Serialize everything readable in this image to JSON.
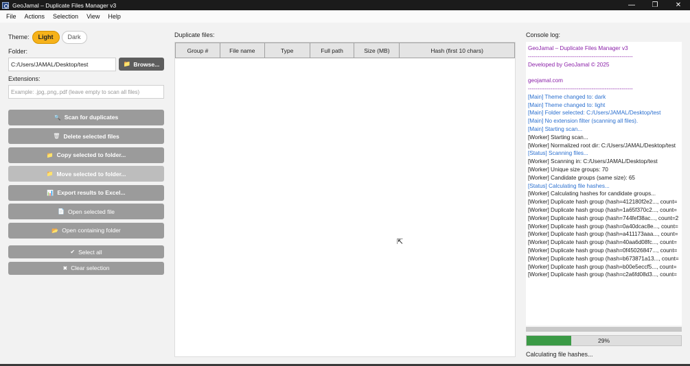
{
  "window": {
    "title": "GeoJamal – Duplicate Files Manager v3",
    "controls": {
      "minimize": "—",
      "restore": "❐",
      "close": "✕"
    }
  },
  "menu": [
    "File",
    "Actions",
    "Selection",
    "View",
    "Help"
  ],
  "left": {
    "theme_label": "Theme:",
    "theme_light": "Light",
    "theme_dark": "Dark",
    "folder_label": "Folder:",
    "folder_value": "C:/Users/JAMAL/Desktop/test",
    "browse_icon": "📁",
    "browse_label": "Browse...",
    "extensions_label": "Extensions:",
    "extensions_placeholder": "Example: .jpg,.png,.pdf (leave empty to scan all files)",
    "buttons": [
      {
        "icon": "🔍",
        "label": "Scan for duplicates"
      },
      {
        "icon": "🗑",
        "label": "Delete selected files"
      },
      {
        "icon": "📁",
        "label": "Copy selected to folder..."
      },
      {
        "icon": "📁",
        "label": "Move selected to folder..."
      },
      {
        "icon": "📊",
        "label": "Export results to Excel..."
      },
      {
        "icon": "📄",
        "label": "Open selected file"
      },
      {
        "icon": "📂",
        "label": "Open containing folder"
      }
    ],
    "select_all": {
      "icon": "✔",
      "label": "Select all"
    },
    "clear_selection": {
      "icon": "✖",
      "label": "Clear selection"
    }
  },
  "main": {
    "label": "Duplicate files:",
    "columns": [
      "Group #",
      "File name",
      "Type",
      "Full path",
      "Size (MB)",
      "Hash (first 10 chars)"
    ],
    "rows": []
  },
  "console": {
    "label": "Console log:",
    "lines": [
      {
        "text": "GeoJamal – Duplicate Files Manager v3",
        "color": "purple"
      },
      {
        "text": "--------------------------------------------------------",
        "color": "purple"
      },
      {
        "text": "Developed by GeoJamal © 2025",
        "color": "purple"
      },
      {
        "text": "",
        "color": "blank"
      },
      {
        "text": "geojamal.com",
        "color": "purple"
      },
      {
        "text": "--------------------------------------------------------",
        "color": "purple"
      },
      {
        "text": "[Main] Theme changed to: dark",
        "color": "blue"
      },
      {
        "text": "[Main] Theme changed to: light",
        "color": "blue"
      },
      {
        "text": "[Main] Folder selected: C:/Users/JAMAL/Desktop/test",
        "color": "blue"
      },
      {
        "text": "[Main] No extension filter (scanning all files).",
        "color": "blue"
      },
      {
        "text": "[Main] Starting scan...",
        "color": "blue"
      },
      {
        "text": "[Worker] Starting scan...",
        "color": "black"
      },
      {
        "text": "[Worker] Normalized root dir: C:/Users/JAMAL/Desktop/test",
        "color": "black"
      },
      {
        "text": "[Status] Scanning files...",
        "color": "blue"
      },
      {
        "text": "[Worker] Scanning in: C:/Users/JAMAL/Desktop/test",
        "color": "black"
      },
      {
        "text": "[Worker] Unique size groups: 70",
        "color": "black"
      },
      {
        "text": "[Worker] Candidate groups (same size): 65",
        "color": "black"
      },
      {
        "text": "[Status] Calculating file hashes...",
        "color": "blue"
      },
      {
        "text": "[Worker] Calculating hashes for candidate groups...",
        "color": "black"
      },
      {
        "text": "[Worker] Duplicate hash group (hash=412180f2e2..., count=",
        "color": "black"
      },
      {
        "text": "[Worker] Duplicate hash group (hash=1a65f370c2..., count=",
        "color": "black"
      },
      {
        "text": "[Worker] Duplicate hash group (hash=744fef38ac..., count=2",
        "color": "black"
      },
      {
        "text": "[Worker] Duplicate hash group (hash=0a40dcac8e..., count=",
        "color": "black"
      },
      {
        "text": "[Worker] Duplicate hash group (hash=a411173aaa..., count=",
        "color": "black"
      },
      {
        "text": "[Worker] Duplicate hash group (hash=40aa6d08fc..., count=",
        "color": "black"
      },
      {
        "text": "[Worker] Duplicate hash group (hash=0f45026847..., count=",
        "color": "black"
      },
      {
        "text": "[Worker] Duplicate hash group (hash=b673871a13..., count=",
        "color": "black"
      },
      {
        "text": "[Worker] Duplicate hash group (hash=b00e5eccf5..., count=",
        "color": "black"
      },
      {
        "text": "[Worker] Duplicate hash group (hash=c2a6fd08d3..., count=",
        "color": "black"
      }
    ]
  },
  "progress": {
    "value": 29,
    "label": "29%"
  },
  "status": "Calculating file hashes...",
  "colors": {
    "accent": "#f6b21a",
    "progress": "#3b9a46",
    "log_main": "#2a6fcf",
    "log_header": "#8a1fa8"
  }
}
